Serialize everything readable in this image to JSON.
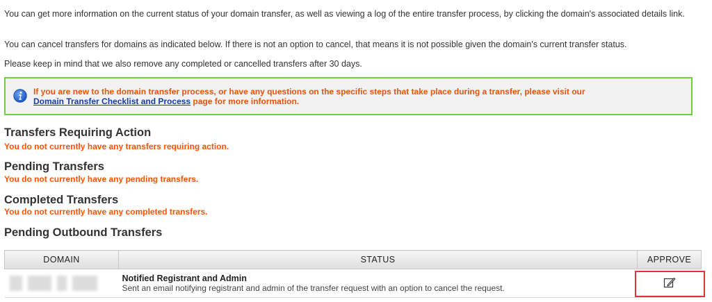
{
  "intro": {
    "p1": "You can get more information on the current status of your domain transfer, as well as viewing a log of the entire transfer process, by clicking the domain's associated details link.",
    "p2": "You can cancel transfers for domains as indicated below. If there is not an option to cancel, that means it is not possible given the domain's current transfer status.",
    "p3": "Please keep in mind that we also remove any completed or cancelled transfers after 30 days."
  },
  "notice": {
    "text_before": "If you are new to the domain transfer process, or have any questions on the specific steps that take place during a transfer, please visit our",
    "link": "Domain Transfer Checklist and Process",
    "text_after": " page for more information.",
    "icon": "info-icon"
  },
  "sections": {
    "requiring_action": {
      "title": "Transfers Requiring Action",
      "message": "You do not currently have any transfers requiring action."
    },
    "pending": {
      "title": "Pending Transfers",
      "message": "You do not currently have any pending transfers."
    },
    "completed": {
      "title": "Completed Transfers",
      "message": "You do not currently have any completed transfers."
    },
    "outbound": {
      "title": "Pending Outbound Transfers"
    }
  },
  "table": {
    "headers": {
      "domain": "DOMAIN",
      "status": "STATUS",
      "approve": "APPROVE"
    },
    "rows": [
      {
        "status_title": "Notified Registrant and Admin",
        "status_desc": "Sent an email notifying registrant and admin of the transfer request with an option to cancel the request.",
        "approve_icon": "edit-icon"
      }
    ]
  },
  "colors": {
    "notice_border": "#6ad23a",
    "warning_text": "#ff5200",
    "link": "#1a3d9e",
    "highlight": "#e23434"
  }
}
